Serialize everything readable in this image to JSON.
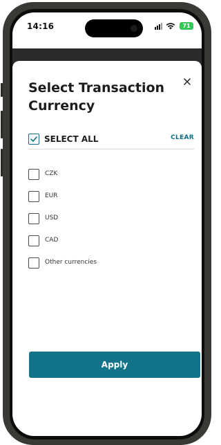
{
  "status_bar": {
    "time": "14:16",
    "battery": "71"
  },
  "sheet": {
    "title": "Select Transaction Currency",
    "select_all_label": "SELECT ALL",
    "select_all_checked": true,
    "clear_label": "CLEAR",
    "options": [
      {
        "label": "CZK",
        "checked": false
      },
      {
        "label": "EUR",
        "checked": false
      },
      {
        "label": "USD",
        "checked": false
      },
      {
        "label": "CAD",
        "checked": false
      },
      {
        "label": "Other currencies",
        "checked": false
      }
    ],
    "apply_label": "Apply"
  },
  "colors": {
    "accent": "#137489",
    "battery": "#34c759"
  }
}
